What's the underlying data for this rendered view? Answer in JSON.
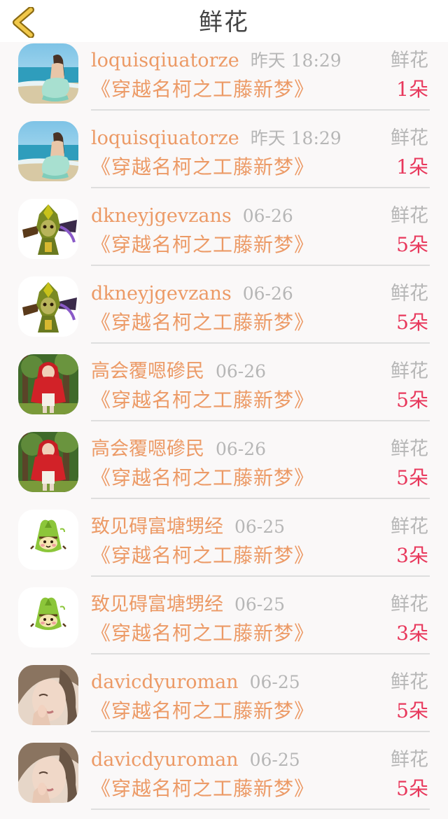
{
  "header": {
    "title": "鲜花"
  },
  "rows": [
    {
      "user": "loquisqiuatorze",
      "time": "昨天 18:29",
      "type": "鲜花",
      "book": "《穿越名柯之工藤新梦》",
      "count": "1朵",
      "avatar_icon": "beach-woman-avatar"
    },
    {
      "user": "loquisqiuatorze",
      "time": "昨天 18:29",
      "type": "鲜花",
      "book": "《穿越名柯之工藤新梦》",
      "count": "1朵",
      "avatar_icon": "beach-woman-avatar"
    },
    {
      "user": "dkneyjgevzans",
      "time": "06-26",
      "type": "鲜花",
      "book": "《穿越名柯之工藤新梦》",
      "count": "5朵",
      "avatar_icon": "game-character-avatar"
    },
    {
      "user": "dkneyjgevzans",
      "time": "06-26",
      "type": "鲜花",
      "book": "《穿越名柯之工藤新梦》",
      "count": "5朵",
      "avatar_icon": "game-character-avatar"
    },
    {
      "user": "高会覆嗯磣民",
      "time": "06-26",
      "type": "鲜花",
      "book": "《穿越名柯之工藤新梦》",
      "count": "5朵",
      "avatar_icon": "red-hood-girl-avatar"
    },
    {
      "user": "高会覆嗯磣民",
      "time": "06-26",
      "type": "鲜花",
      "book": "《穿越名柯之工藤新梦》",
      "count": "5朵",
      "avatar_icon": "red-hood-girl-avatar"
    },
    {
      "user": "致见碍富塘甥经",
      "time": "06-25",
      "type": "鲜花",
      "book": "《穿越名柯之工藤新梦》",
      "count": "3朵",
      "avatar_icon": "zongzi-cartoon-avatar"
    },
    {
      "user": "致见碍富塘甥经",
      "time": "06-25",
      "type": "鲜花",
      "book": "《穿越名柯之工藤新梦》",
      "count": "3朵",
      "avatar_icon": "zongzi-cartoon-avatar"
    },
    {
      "user": "davicdyuroman",
      "time": "06-25",
      "type": "鲜花",
      "book": "《穿越名柯之工藤新梦》",
      "count": "5朵",
      "avatar_icon": "woman-portrait-avatar"
    },
    {
      "user": "davicdyuroman",
      "time": "06-25",
      "type": "鲜花",
      "book": "《穿越名柯之工藤新梦》",
      "count": "5朵",
      "avatar_icon": "woman-portrait-avatar"
    }
  ],
  "colors": {
    "accent": "#ec9a66",
    "count": "#e8385c",
    "muted": "#b6b6b6",
    "back_arrow": "#e8b93a"
  }
}
